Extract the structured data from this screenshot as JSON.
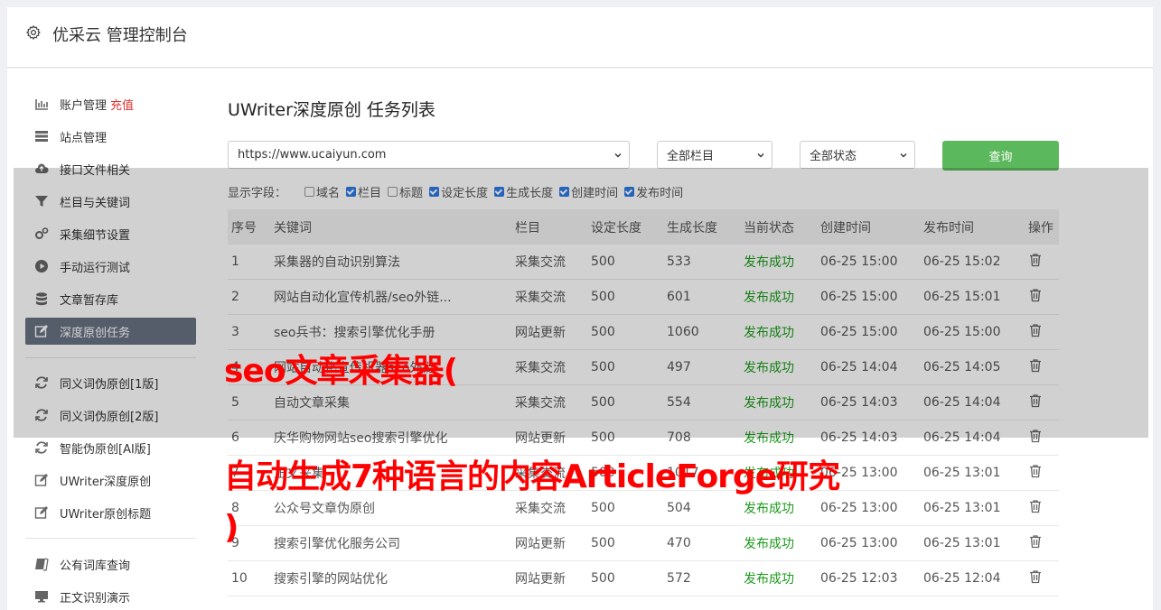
{
  "app": {
    "title": "优采云 管理控制台",
    "icon": "gear-icon"
  },
  "sidebar": {
    "items": [
      {
        "label": "账户管理",
        "tag": "充值",
        "icon": "bar-chart-icon"
      },
      {
        "label": "站点管理",
        "icon": "server-icon"
      },
      {
        "label": "接口文件相关",
        "icon": "cloud-upload-icon"
      },
      {
        "label": "栏目与关键词",
        "icon": "filter-icon"
      },
      {
        "label": "采集细节设置",
        "icon": "gears-icon"
      },
      {
        "label": "手动运行测试",
        "icon": "play-circle-icon"
      },
      {
        "label": "文章暂存库",
        "icon": "database-icon"
      },
      {
        "label": "深度原创任务",
        "icon": "edit-icon",
        "active": true
      },
      {
        "label": "同义词伪原创[1版]",
        "icon": "refresh-icon"
      },
      {
        "label": "同义词伪原创[2版]",
        "icon": "refresh-icon"
      },
      {
        "label": "智能伪原创[AI版]",
        "icon": "refresh-icon"
      },
      {
        "label": "UWriter深度原创",
        "icon": "edit-icon"
      },
      {
        "label": "UWriter原创标题",
        "icon": "edit-icon"
      },
      {
        "label": "公有词库查询",
        "icon": "book-icon"
      },
      {
        "label": "正文识别演示",
        "icon": "monitor-icon"
      }
    ]
  },
  "main": {
    "title": "UWriter深度原创 任务列表",
    "site_select": "https://www.ucaiyun.com",
    "column_select": "全部栏目",
    "status_select": "全部状态",
    "query_button": "查询",
    "fields_label": "显示字段：",
    "fields": [
      {
        "label": "域名",
        "checked": false
      },
      {
        "label": "栏目",
        "checked": true
      },
      {
        "label": "标题",
        "checked": false
      },
      {
        "label": "设定长度",
        "checked": true
      },
      {
        "label": "生成长度",
        "checked": true
      },
      {
        "label": "创建时间",
        "checked": true
      },
      {
        "label": "发布时间",
        "checked": true
      }
    ],
    "columns": [
      "序号",
      "关键词",
      "栏目",
      "设定长度",
      "生成长度",
      "当前状态",
      "创建时间",
      "发布时间",
      "操作"
    ],
    "rows": [
      [
        "1",
        "采集器的自动识别算法",
        "采集交流",
        "500",
        "533",
        "发布成功",
        "06-25 15:00",
        "06-25 15:02"
      ],
      [
        "2",
        "网站自动化宣传机器/seo外链...",
        "采集交流",
        "500",
        "601",
        "发布成功",
        "06-25 15:00",
        "06-25 15:01"
      ],
      [
        "3",
        "seo兵书：搜索引擎优化手册",
        "网站更新",
        "500",
        "1060",
        "发布成功",
        "06-25 15:00",
        "06-25 15:00"
      ],
      [
        "4",
        "网站自动化宣传机器seo外链",
        "采集交流",
        "500",
        "497",
        "发布成功",
        "06-25 14:04",
        "06-25 14:05"
      ],
      [
        "5",
        "自动文章采集",
        "采集交流",
        "500",
        "554",
        "发布成功",
        "06-25 14:03",
        "06-25 14:04"
      ],
      [
        "6",
        "庆华购物网站seo搜索引擎优化",
        "网站更新",
        "500",
        "708",
        "发布成功",
        "06-25 14:03",
        "06-25 14:04"
      ],
      [
        "7",
        "正文采集",
        "采集交流",
        "500",
        "1017",
        "发布成功",
        "06-25 13:00",
        "06-25 13:01"
      ],
      [
        "8",
        "公众号文章伪原创",
        "采集交流",
        "500",
        "504",
        "发布成功",
        "06-25 13:00",
        "06-25 13:01"
      ],
      [
        "9",
        "搜索引擎优化服务公司",
        "网站更新",
        "500",
        "470",
        "发布成功",
        "06-25 13:00",
        "06-25 13:01"
      ],
      [
        "10",
        "搜索引擎的网站优化",
        "网站更新",
        "500",
        "572",
        "发布成功",
        "06-25 12:03",
        "06-25 12:04"
      ]
    ],
    "status_color": "#1a9a1a"
  },
  "banner": {
    "line1": "seo文章采集器(",
    "line2": "自动生成7种语言的内容ArticleForge研究",
    "line3": ")"
  }
}
